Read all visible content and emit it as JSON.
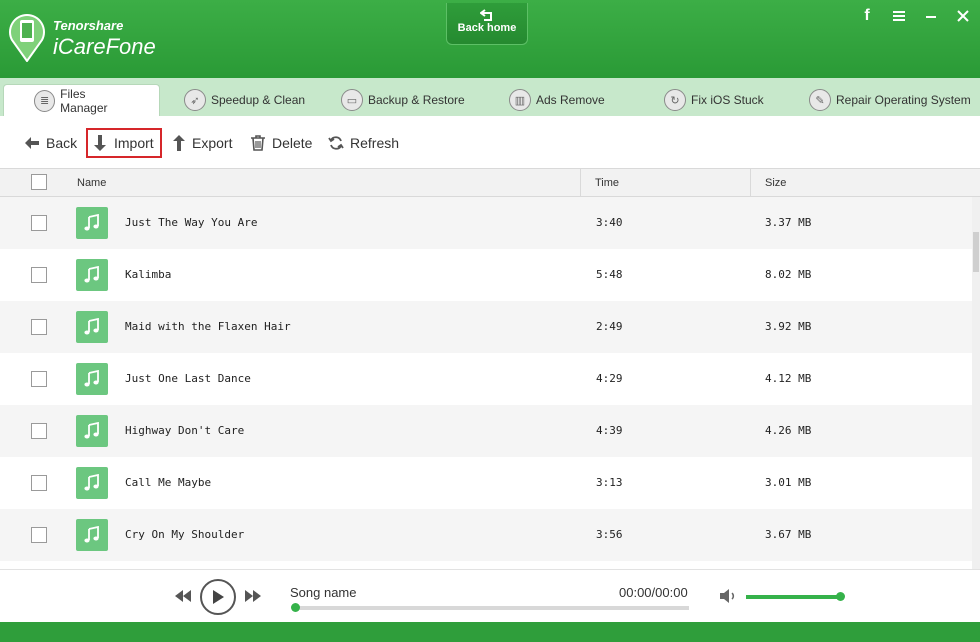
{
  "header": {
    "brand_small": "Tenorshare",
    "brand_name": "iCareFone",
    "back_home_label": "Back home",
    "window_buttons": [
      "facebook-icon",
      "menu-icon",
      "minimize-icon",
      "close-icon"
    ]
  },
  "tabs": [
    {
      "label": "Files Manager",
      "icon": "files-icon",
      "active": true
    },
    {
      "label": "Speedup & Clean",
      "icon": "rocket-icon",
      "active": false
    },
    {
      "label": "Backup & Restore",
      "icon": "backup-icon",
      "active": false
    },
    {
      "label": "Ads Remove",
      "icon": "trash-icon",
      "active": false
    },
    {
      "label": "Fix iOS Stuck",
      "icon": "refresh-icon",
      "active": false
    },
    {
      "label": "Repair Operating System",
      "icon": "wrench-icon",
      "active": false
    }
  ],
  "toolbar": {
    "back": "Back",
    "import": "Import",
    "export": "Export",
    "delete": "Delete",
    "refresh": "Refresh"
  },
  "table": {
    "columns": [
      "Name",
      "Time",
      "Size"
    ],
    "rows": [
      {
        "name": "Just The Way You Are",
        "time": "3:40",
        "size": "3.37 MB"
      },
      {
        "name": "Kalimba",
        "time": "5:48",
        "size": "8.02 MB"
      },
      {
        "name": "Maid with the Flaxen Hair",
        "time": "2:49",
        "size": "3.92 MB"
      },
      {
        "name": "Just One Last Dance",
        "time": "4:29",
        "size": "4.12 MB"
      },
      {
        "name": "Highway Don't Care",
        "time": "4:39",
        "size": "4.26 MB"
      },
      {
        "name": "Call Me Maybe",
        "time": "3:13",
        "size": "3.01 MB"
      },
      {
        "name": "Cry On My Shoulder",
        "time": "3:56",
        "size": "3.67 MB"
      }
    ]
  },
  "player": {
    "song_name": "Song name",
    "time": "00:00/00:00",
    "progress": 0,
    "volume": 0.95
  },
  "colors": {
    "brand_green": "#2a9a36",
    "tab_bar": "#c7e8cb",
    "highlight_red": "#d6262a",
    "music_tile": "#6cc780"
  }
}
